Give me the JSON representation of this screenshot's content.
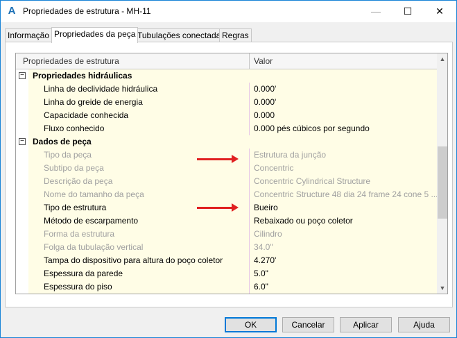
{
  "window": {
    "title": "Propriedades de estrutura - MH-11",
    "app_icon": "A",
    "minimize_glyph": "—",
    "maximize_glyph": "☐",
    "close_glyph": "✕"
  },
  "tabs": [
    {
      "label": "Informação",
      "active": false
    },
    {
      "label": "Propriedades da peça",
      "active": true
    },
    {
      "label": "Tubulações conectadas",
      "active": false
    },
    {
      "label": "Regras",
      "active": false
    }
  ],
  "grid": {
    "header_name": "Propriedades de estrutura",
    "header_value": "Valor",
    "rows": [
      {
        "type": "category",
        "name": "Propriedades hidráulicas",
        "expander": "⊟"
      },
      {
        "type": "prop",
        "name": "Linha de declividade hidráulica",
        "value": "0.000'",
        "readonly": false
      },
      {
        "type": "prop",
        "name": "Linha do greide de energia",
        "value": "0.000'",
        "readonly": false
      },
      {
        "type": "prop",
        "name": "Capacidade conhecida",
        "value": "0.000",
        "readonly": false
      },
      {
        "type": "prop",
        "name": "Fluxo conhecido",
        "value": "0.000 pés cúbicos por segundo",
        "readonly": false
      },
      {
        "type": "category",
        "name": "Dados de peça",
        "expander": "⊟"
      },
      {
        "type": "prop",
        "name": "Tipo da peça",
        "value": "Estrutura da junção",
        "readonly": true
      },
      {
        "type": "prop",
        "name": "Subtipo da peça",
        "value": "Concentric",
        "readonly": true
      },
      {
        "type": "prop",
        "name": "Descrição da peça",
        "value": "Concentric Cylindrical Structure",
        "readonly": true
      },
      {
        "type": "prop",
        "name": "Nome do tamanho da peça",
        "value": "Concentric Structure 48 dia 24 frame 24 cone 5 ...",
        "readonly": true
      },
      {
        "type": "prop",
        "name": "Tipo de estrutura",
        "value": "Bueiro",
        "readonly": false
      },
      {
        "type": "prop",
        "name": "Método de escarpamento",
        "value": "Rebaixado ou poço coletor",
        "readonly": false
      },
      {
        "type": "prop",
        "name": "Forma da estrutura",
        "value": "Cilindro",
        "readonly": true
      },
      {
        "type": "prop",
        "name": "Folga da tubulação vertical",
        "value": "34.0\"",
        "readonly": true
      },
      {
        "type": "prop",
        "name": "Tampa do dispositivo para altura do poço coletor",
        "value": "4.270'",
        "readonly": false
      },
      {
        "type": "prop",
        "name": "Espessura da parede",
        "value": "5.0\"",
        "readonly": false
      },
      {
        "type": "prop",
        "name": "Espessura do piso",
        "value": "6.0\"",
        "readonly": false
      }
    ]
  },
  "buttons": {
    "ok": "OK",
    "cancel": "Cancelar",
    "apply": "Aplicar",
    "help": "Ajuda"
  },
  "colors": {
    "annotation_arrow": "#e02020",
    "property_bg": "#fffde6",
    "readonly_text": "#a0a0a0"
  }
}
